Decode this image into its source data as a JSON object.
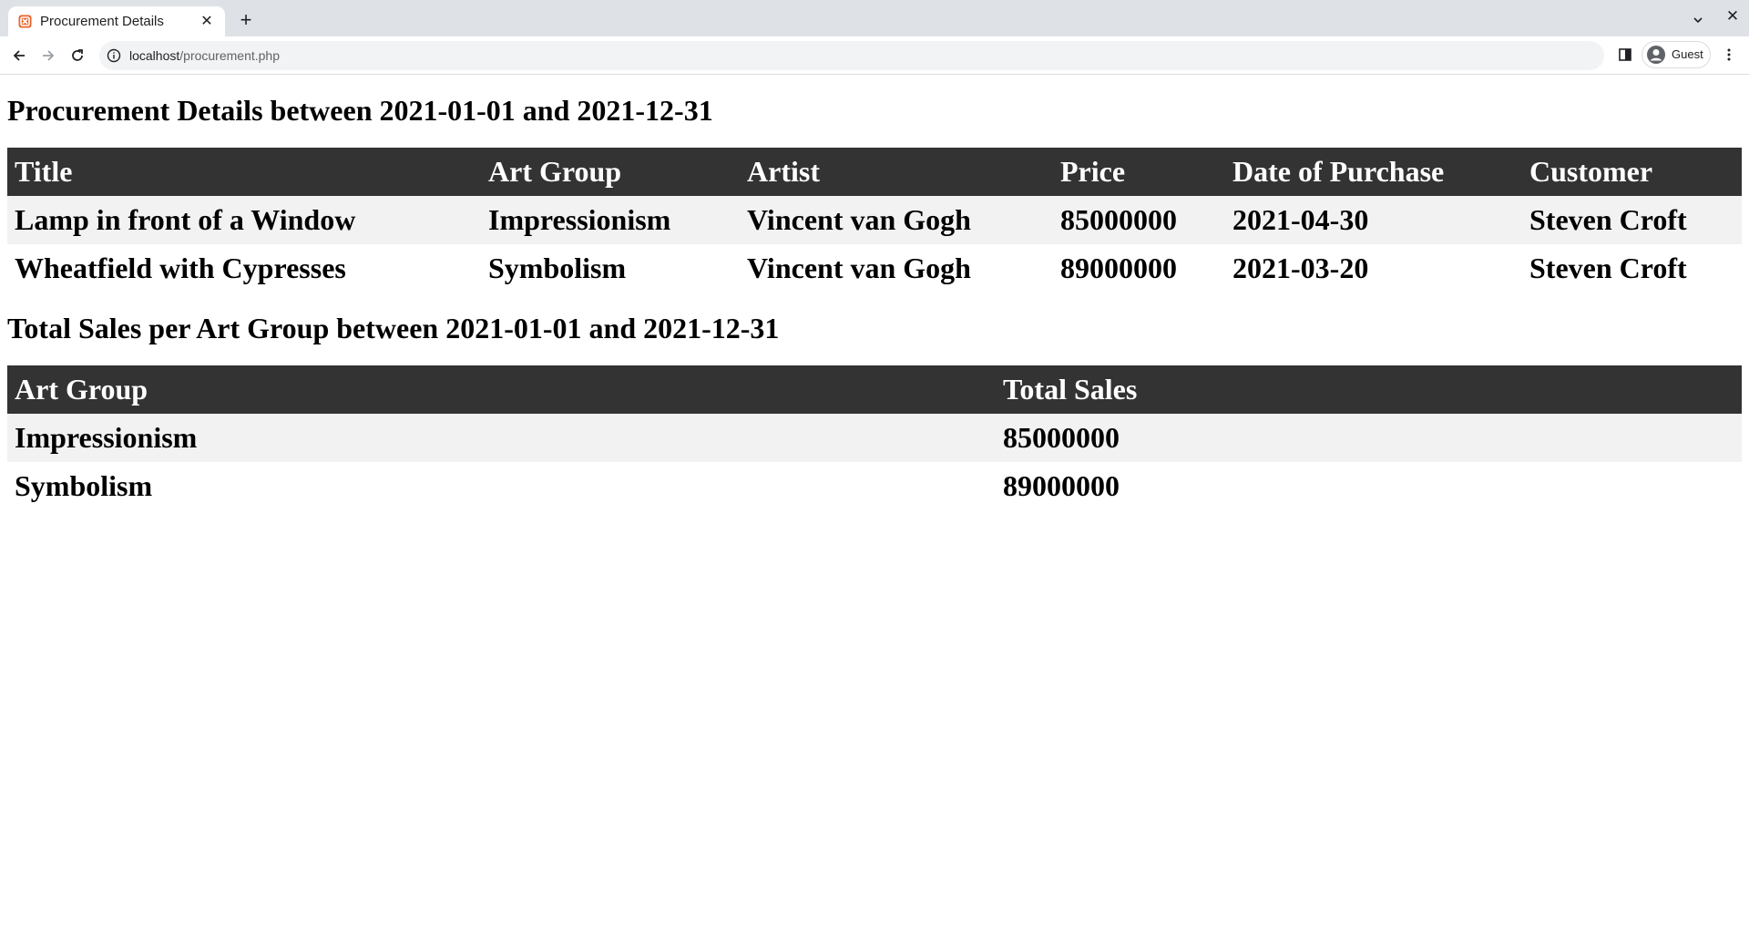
{
  "browser": {
    "tab_title": "Procurement Details",
    "url_host": "localhost",
    "url_path": "/procurement.php",
    "profile_label": "Guest"
  },
  "page": {
    "details_heading": "Procurement Details between 2021-01-01 and 2021-12-31",
    "details_columns": [
      "Title",
      "Art Group",
      "Artist",
      "Price",
      "Date of Purchase",
      "Customer"
    ],
    "details_rows": [
      [
        "Lamp in front of a Window",
        "Impressionism",
        "Vincent van Gogh",
        "85000000",
        "2021-04-30",
        "Steven Croft"
      ],
      [
        "Wheatfield with Cypresses",
        "Symbolism",
        "Vincent van Gogh",
        "89000000",
        "2021-03-20",
        "Steven Croft"
      ]
    ],
    "totals_heading": "Total Sales per Art Group between 2021-01-01 and 2021-12-31",
    "totals_columns": [
      "Art Group",
      "Total Sales"
    ],
    "totals_rows": [
      [
        "Impressionism",
        "85000000"
      ],
      [
        "Symbolism",
        "89000000"
      ]
    ]
  },
  "colors": {
    "header_row": "#333333",
    "stripe_row": "#f2f2f2",
    "favicon": "#e8652b"
  },
  "icons": [
    "xampp-favicon-icon",
    "close-icon",
    "plus-icon",
    "chevron-down-icon",
    "back-arrow-icon",
    "forward-arrow-icon",
    "reload-icon",
    "info-icon",
    "side-panel-icon",
    "avatar-icon",
    "kebab-menu-icon"
  ]
}
